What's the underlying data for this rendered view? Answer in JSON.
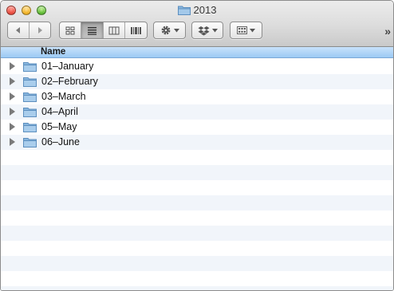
{
  "window": {
    "title": "2013"
  },
  "toolbar": {
    "back_icon": "back-arrow-icon",
    "forward_icon": "forward-arrow-icon",
    "views": [
      "icon-view-icon",
      "list-view-icon",
      "column-view-icon",
      "coverflow-view-icon"
    ],
    "active_view": "list-view-icon",
    "action_icon": "gear-icon",
    "dropbox_icon": "dropbox-icon",
    "arrange_icon": "arrange-grid-icon",
    "overflow_label": "»"
  },
  "list": {
    "column_header": "Name",
    "items": [
      {
        "label": "01–January"
      },
      {
        "label": "02–February"
      },
      {
        "label": "03–March"
      },
      {
        "label": "04–April"
      },
      {
        "label": "05–May"
      },
      {
        "label": "06–June"
      }
    ]
  },
  "colors": {
    "header_blue": "#9ccaf4",
    "folder_blue": "#8ab7de",
    "row_alt": "#f1f5fa"
  }
}
